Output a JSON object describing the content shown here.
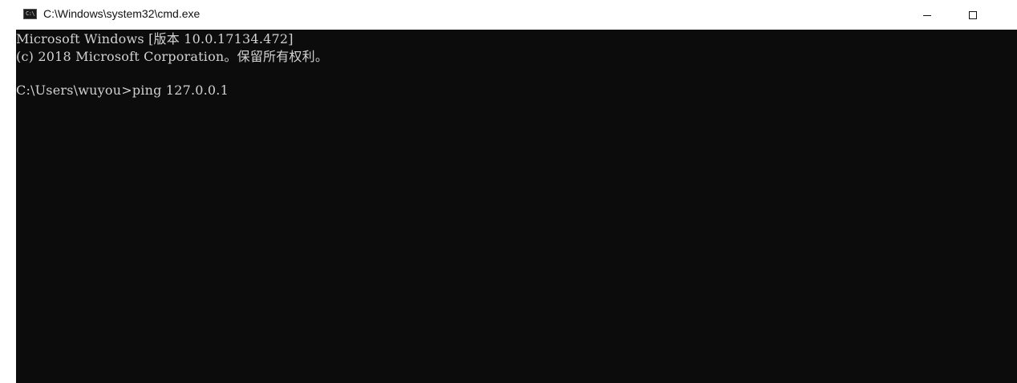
{
  "window": {
    "title": "C:\\Windows\\system32\\cmd.exe",
    "icon": "cmd-icon",
    "icon_glyph": "C:\\",
    "controls": [
      "minimize-icon",
      "maximize-icon"
    ]
  },
  "console": {
    "lines": [
      "Microsoft Windows [版本 10.0.17134.472]",
      "(c) 2018 Microsoft Corporation。保留所有权利。",
      "C:\\Users\\wuyou>ping 127.0.0.1"
    ]
  },
  "colors": {
    "console_background": "#0c0c0c",
    "console_text": "#d2d2d2",
    "titlebar_background": "#ffffff"
  }
}
